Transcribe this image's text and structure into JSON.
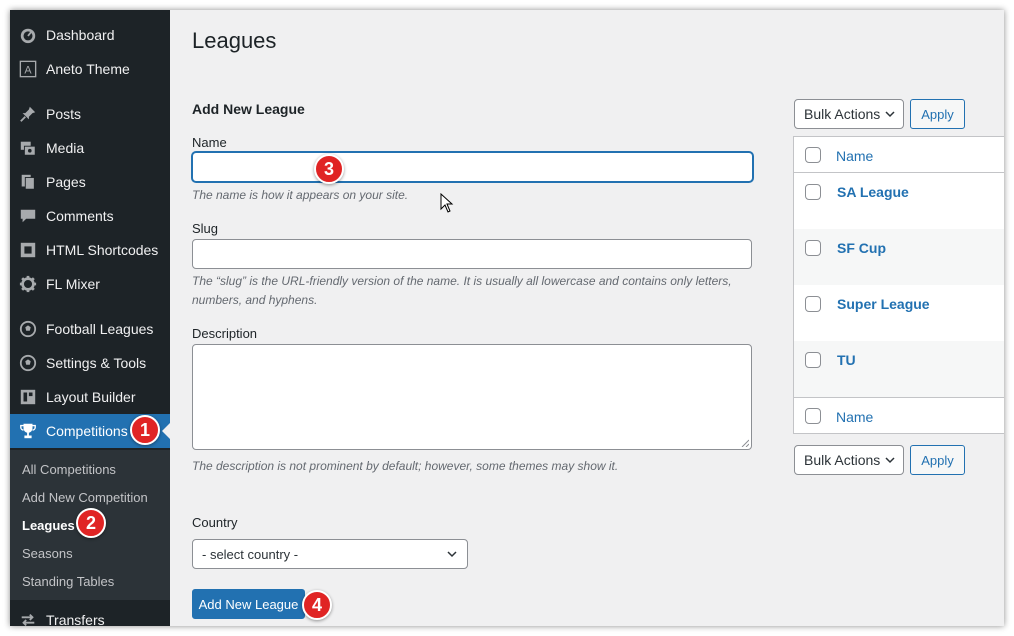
{
  "sidebar": {
    "items": [
      {
        "label": "Dashboard",
        "icon": "dashboard-icon"
      },
      {
        "label": "Aneto Theme",
        "icon": "theme-a-icon"
      },
      {
        "label": "Posts",
        "icon": "pushpin-icon"
      },
      {
        "label": "Media",
        "icon": "media-icon"
      },
      {
        "label": "Pages",
        "icon": "pages-icon"
      },
      {
        "label": "Comments",
        "icon": "comments-icon"
      },
      {
        "label": "HTML Shortcodes",
        "icon": "shortcode-icon"
      },
      {
        "label": "FL Mixer",
        "icon": "gear-icon"
      },
      {
        "label": "Football Leagues",
        "icon": "soccer-ball-icon"
      },
      {
        "label": "Settings & Tools",
        "icon": "soccer-ball-icon"
      },
      {
        "label": "Layout Builder",
        "icon": "layout-icon"
      },
      {
        "label": "Competitions",
        "icon": "trophy-icon"
      },
      {
        "label": "Transfers",
        "icon": "transfer-arrows-icon"
      }
    ],
    "submenu": [
      {
        "label": "All Competitions"
      },
      {
        "label": "Add New Competition"
      },
      {
        "label": "Leagues",
        "current": true
      },
      {
        "label": "Seasons"
      },
      {
        "label": "Standing Tables"
      }
    ]
  },
  "page": {
    "title": "Leagues"
  },
  "form": {
    "heading": "Add New League",
    "name_label": "Name",
    "name_value": "",
    "name_hint": "The name is how it appears on your site.",
    "slug_label": "Slug",
    "slug_value": "",
    "slug_hint": "The “slug” is the URL-friendly version of the name. It is usually all lowercase and contains only letters, numbers, and hyphens.",
    "description_label": "Description",
    "description_value": "",
    "description_hint": "The description is not prominent by default; however, some themes may show it.",
    "country_label": "Country",
    "country_selected": "- select country -",
    "submit_label": "Add New League"
  },
  "list": {
    "bulk_actions_label": "Bulk Actions",
    "apply_label": "Apply",
    "column_name": "Name",
    "rows": [
      "SA League",
      "SF Cup",
      "Super League",
      "TU"
    ]
  },
  "badges": [
    "1",
    "2",
    "3",
    "4"
  ],
  "colors": {
    "sidebar_bg": "#1d2327",
    "active_menu": "#2271b1",
    "badge": "#e02424",
    "link": "#2271b1"
  }
}
